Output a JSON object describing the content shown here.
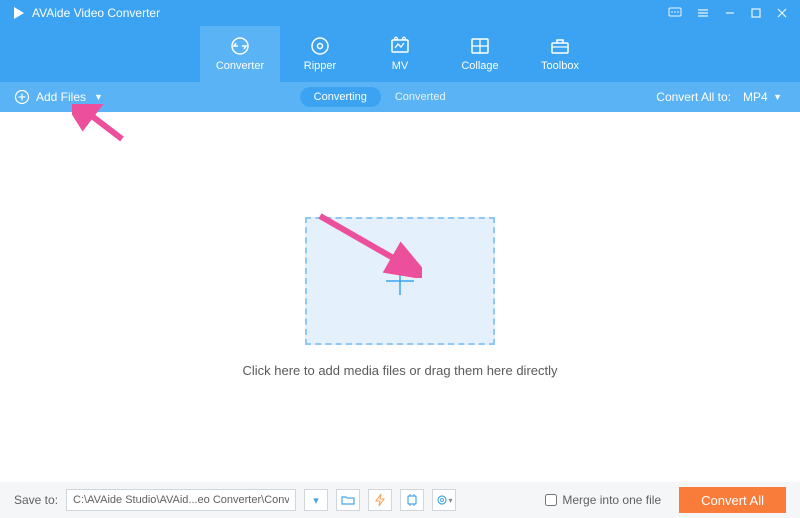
{
  "app": {
    "title": "AVAide Video Converter"
  },
  "tabs": [
    {
      "label": "Converter"
    },
    {
      "label": "Ripper"
    },
    {
      "label": "MV"
    },
    {
      "label": "Collage"
    },
    {
      "label": "Toolbox"
    }
  ],
  "subbar": {
    "add_files": "Add Files",
    "converting": "Converting",
    "converted": "Converted",
    "convert_all_label": "Convert All to:",
    "convert_all_value": "MP4"
  },
  "main": {
    "hint": "Click here to add media files or drag them here directly"
  },
  "footer": {
    "save_label": "Save to:",
    "path": "C:\\AVAide Studio\\AVAid...eo Converter\\Converted",
    "merge_label": "Merge into one file",
    "convert_btn": "Convert All"
  }
}
